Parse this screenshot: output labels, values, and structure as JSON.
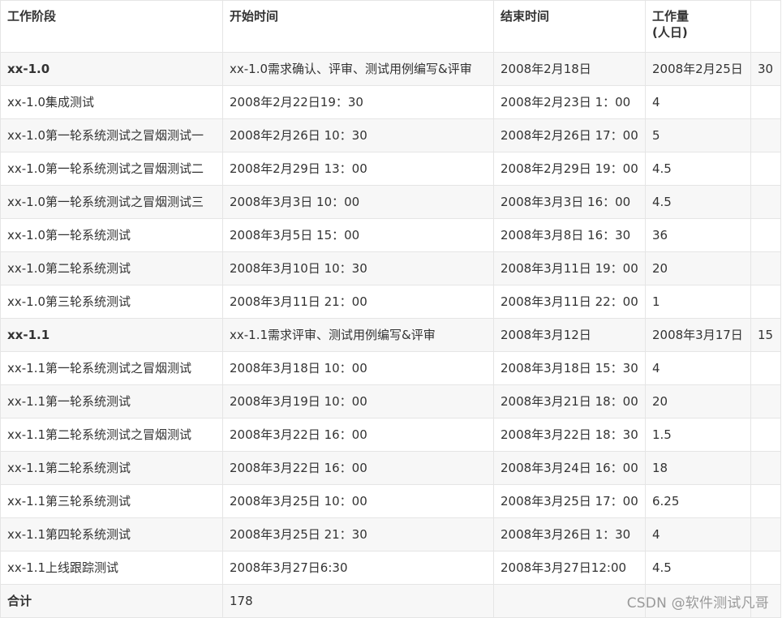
{
  "table": {
    "headers": [
      "工作阶段",
      "开始时间",
      "结束时间",
      "工作量",
      "(人日)",
      ""
    ],
    "rows": [
      [
        "xx-1.0",
        "xx-1.0需求确认、评审、测试用例编写&评审",
        "2008年2月18日",
        "2008年2月25日",
        "30"
      ],
      [
        "xx-1.0集成测试",
        "2008年2月22日19：30",
        "2008年2月23日 1：00",
        "4",
        ""
      ],
      [
        "xx-1.0第一轮系统测试之冒烟测试一",
        "2008年2月26日 10：30",
        "2008年2月26日 17：00",
        "5",
        ""
      ],
      [
        "xx-1.0第一轮系统测试之冒烟测试二",
        "2008年2月29日 13：00",
        "2008年2月29日 19：00",
        "4.5",
        ""
      ],
      [
        "xx-1.0第一轮系统测试之冒烟测试三",
        "2008年3月3日 10：00",
        "2008年3月3日 16：00",
        "4.5",
        ""
      ],
      [
        "xx-1.0第一轮系统测试",
        "2008年3月5日 15：00",
        "2008年3月8日 16：30",
        "36",
        ""
      ],
      [
        "xx-1.0第二轮系统测试",
        "2008年3月10日 10：30",
        "2008年3月11日 19：00",
        "20",
        ""
      ],
      [
        "xx-1.0第三轮系统测试",
        "2008年3月11日 21：00",
        "2008年3月11日 22：00",
        "1",
        ""
      ],
      [
        "xx-1.1",
        "xx-1.1需求评审、测试用例编写&评审",
        "2008年3月12日",
        "2008年3月17日",
        "15"
      ],
      [
        "xx-1.1第一轮系统测试之冒烟测试",
        "2008年3月18日 10：00",
        "2008年3月18日 15：30",
        "4",
        ""
      ],
      [
        "xx-1.1第一轮系统测试",
        "2008年3月19日 10：00",
        "2008年3月21日 18：00",
        "20",
        ""
      ],
      [
        "xx-1.1第二轮系统测试之冒烟测试",
        "2008年3月22日 16：00",
        "2008年3月22日 18：30",
        "1.5",
        ""
      ],
      [
        "xx-1.1第二轮系统测试",
        "2008年3月22日 16：00",
        "2008年3月24日 16：00",
        "18",
        ""
      ],
      [
        "xx-1.1第三轮系统测试",
        "2008年3月25日 10：00",
        "2008年3月25日 17：00",
        "6.25",
        ""
      ],
      [
        "xx-1.1第四轮系统测试",
        "2008年3月25日 21：30",
        "2008年3月26日 1：30",
        "4",
        ""
      ],
      [
        "xx-1.1上线跟踪测试",
        "2008年3月27日6:30",
        "2008年3月27日12:00",
        "4.5",
        ""
      ],
      [
        "合计",
        "178",
        "",
        "",
        ""
      ]
    ],
    "bold_rows": [
      0,
      8,
      16
    ]
  },
  "watermark": "CSDN @软件测试凡哥"
}
